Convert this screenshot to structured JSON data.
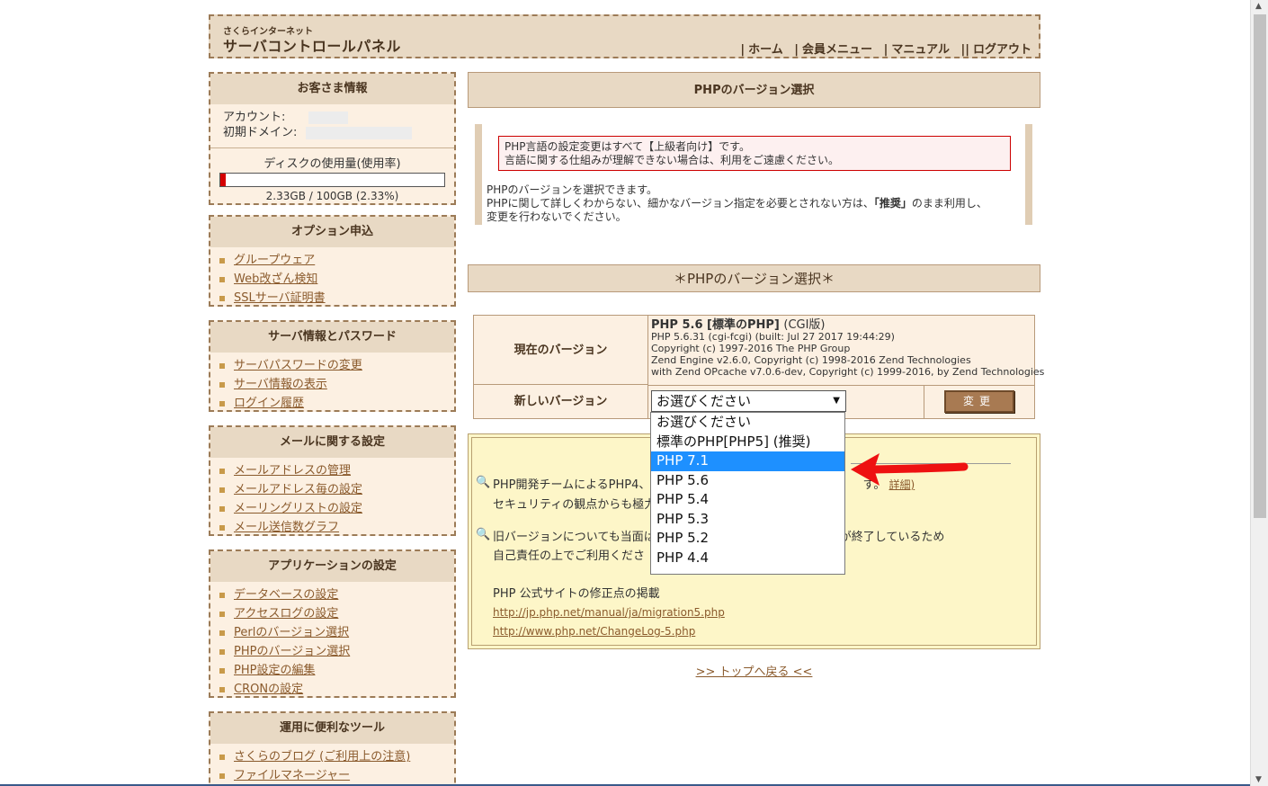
{
  "header": {
    "logo_sub": "さくらインターネット",
    "logo_main": "サーバコントロールパネル",
    "nav": [
      "ホーム",
      "会員メニュー",
      "マニュアル",
      "ログアウト"
    ]
  },
  "sidebar": {
    "customer": {
      "title": "お客さま情報",
      "account_label": "アカウント:",
      "domain_label": "初期ドメイン:",
      "disk_label": "ディスクの使用量(使用率)",
      "disk_usage": "2.33GB / 100GB (2.33%)",
      "disk_fraction": 0.0233
    },
    "options": {
      "title": "オプション申込",
      "items": [
        "グループウェア",
        "Web改ざん検知",
        "SSLサーバ証明書"
      ]
    },
    "server": {
      "title": "サーバ情報とパスワード",
      "items": [
        "サーバパスワードの変更",
        "サーバ情報の表示",
        "ログイン履歴"
      ]
    },
    "mail": {
      "title": "メールに関する設定",
      "items": [
        "メールアドレスの管理",
        "メールアドレス毎の設定",
        "メーリングリストの設定",
        "メール送信数グラフ"
      ]
    },
    "apps": {
      "title": "アプリケーションの設定",
      "items": [
        "データベースの設定",
        "アクセスログの設定",
        "Perlのバージョン選択",
        "PHPのバージョン選択",
        "PHP設定の編集",
        "CRONの設定"
      ]
    },
    "tools": {
      "title": "運用に便利なツール",
      "items": [
        "さくらのブログ (ご利用上の注意)",
        "ファイルマネージャー"
      ]
    }
  },
  "main": {
    "page_title": "PHPのバージョン選択",
    "warn_line1": "PHP言語の設定変更はすべて【上級者向け】です。",
    "warn_line2": "言語に関する仕組みが理解できない場合は、利用をご遠慮ください。",
    "desc_line1": "PHPのバージョンを選択できます。",
    "desc_line2_a": "PHPに関して詳しくわからない、細かなバージョン指定を必要とされない方は、",
    "desc_line2_b": "「推奨」",
    "desc_line2_c": "のまま利用し、",
    "desc_line3": "変更を行わないでください。",
    "section_title": "＊PHPのバージョン選択＊",
    "table": {
      "current_label": "現在のバージョン",
      "new_label": "新しいバージョン",
      "current_main": "PHP 5.6 [標準のPHP]",
      "current_main_suffix": "(CGI版)",
      "current_lines": [
        "PHP 5.6.31 (cgi-fcgi) (built: Jul 27 2017 19:44:29)",
        "Copyright (c) 1997-2016 The PHP Group",
        "Zend Engine v2.6.0, Copyright (c) 1998-2016 Zend Technologies",
        "with Zend OPcache v7.0.6-dev, Copyright (c) 1999-2016, by Zend Technologies"
      ],
      "select_value": "お選びください",
      "change_button": "変更"
    },
    "dropdown_options": [
      "お選びください",
      "標準のPHP[PHP5] (推奨)",
      "PHP 7.1",
      "PHP 5.6",
      "PHP 5.4",
      "PHP 5.3",
      "PHP 5.2",
      "PHP 4.4"
    ],
    "dropdown_selected_index": 2,
    "info": {
      "line1a": "PHP開発チームによるPHP4、5",
      "line1b": "す。",
      "line1_link": "詳細)",
      "line2a": "セキュリティの観点からも極力新",
      "line2b": "。",
      "line3a": "旧バージョンについても当面は提",
      "line3b": "が終了しているため",
      "line4": "自己責任の上でご利用くださ",
      "line5": "PHP 公式サイトの修正点の掲載",
      "link1": "http://jp.php.net/manual/ja/migration5.php",
      "link2": "http://www.php.net/ChangeLog-5.php"
    },
    "back_to_top": ">> トップへ戻る <<"
  },
  "colors": {
    "accent_border": "#9c7b57",
    "header_bg": "#e8d9c4",
    "box_bg": "#fcf0e2",
    "link": "#8a5a2c",
    "warn_border": "#cc0000",
    "selected_option": "#1e90ff",
    "annotation_arrow": "#ee1111"
  },
  "icons": {
    "bullet": "square-bullet-icon",
    "info": "magnifier-icon",
    "annotation": "red-arrow-icon"
  }
}
